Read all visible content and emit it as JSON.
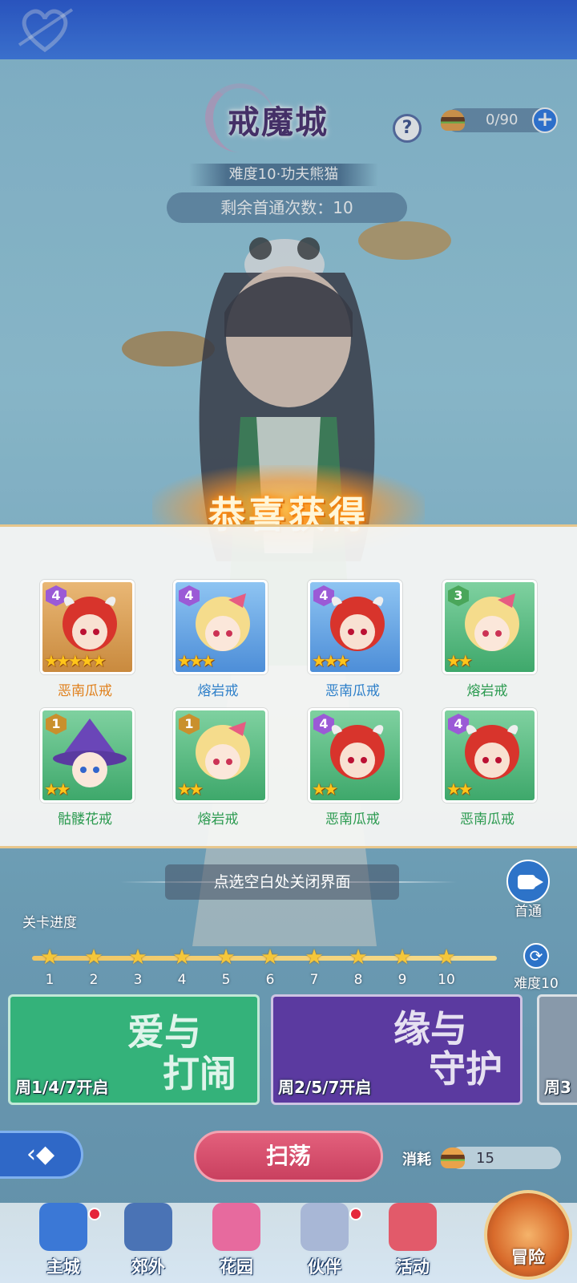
{
  "stage": {
    "title": "戒魔城",
    "difficulty_banner": "难度10·功夫熊猫",
    "remaining_first_clears": "剩余首通次数：10",
    "stamina": "0/90",
    "help_symbol": "?",
    "plus_symbol": "+"
  },
  "reward": {
    "title": "恭喜获得",
    "close_hint": "点选空白处关闭界面",
    "items": [
      {
        "name": "恶南瓜戒",
        "level": "4",
        "stars": "★★★★★",
        "rarity": "orange"
      },
      {
        "name": "熔岩戒",
        "level": "4",
        "stars": "★★★",
        "rarity": "blue"
      },
      {
        "name": "恶南瓜戒",
        "level": "4",
        "stars": "★★★",
        "rarity": "blue"
      },
      {
        "name": "熔岩戒",
        "level": "3",
        "stars": "★★",
        "rarity": "green"
      },
      {
        "name": "骷髅花戒",
        "level": "1",
        "stars": "★★",
        "rarity": "green"
      },
      {
        "name": "熔岩戒",
        "level": "1",
        "stars": "★★",
        "rarity": "green"
      },
      {
        "name": "恶南瓜戒",
        "level": "4",
        "stars": "★★",
        "rarity": "green"
      },
      {
        "name": "恶南瓜戒",
        "level": "4",
        "stars": "★★",
        "rarity": "green"
      }
    ]
  },
  "first_clear": {
    "label": "首通"
  },
  "progress": {
    "label": "关卡进度",
    "steps": [
      "1",
      "2",
      "3",
      "4",
      "5",
      "6",
      "7",
      "8",
      "9",
      "10"
    ],
    "difficulty_switch": "难度10"
  },
  "events": [
    {
      "title_line1": "爱与",
      "title_line2": "打闹",
      "schedule": "周1/4/7开启",
      "color": "#34b27a"
    },
    {
      "title_line1": "缘与",
      "title_line2": "守护",
      "schedule": "周2/5/7开启",
      "color": "#5b3aa0"
    },
    {
      "title_line1": "",
      "title_line2": "",
      "schedule": "周3",
      "color": "#8899aa"
    }
  ],
  "actions": {
    "back_symbol": "‹◆",
    "sweep": "扫荡",
    "cost_label": "消耗",
    "cost_value": "15"
  },
  "nav": [
    {
      "label": "主城",
      "icon": "castle-icon",
      "dot": true
    },
    {
      "label": "郊外",
      "icon": "outskirts-icon",
      "dot": false
    },
    {
      "label": "花园",
      "icon": "garden-heart-icon",
      "dot": false
    },
    {
      "label": "伙伴",
      "icon": "partner-icon",
      "dot": true
    },
    {
      "label": "活动",
      "icon": "gift-icon",
      "dot": false
    },
    {
      "label": "冒险",
      "icon": "adventure-icon",
      "dot": false
    }
  ]
}
